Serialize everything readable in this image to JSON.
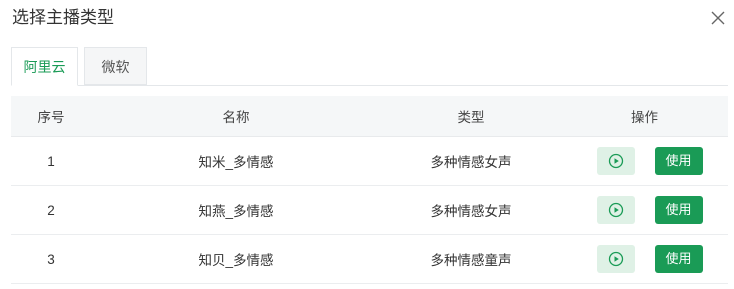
{
  "dialog": {
    "title": "选择主播类型"
  },
  "tabs": [
    {
      "label": "阿里云",
      "active": true
    },
    {
      "label": "微软",
      "active": false
    }
  ],
  "table": {
    "headers": [
      "序号",
      "名称",
      "类型",
      "操作"
    ],
    "rows": [
      {
        "index": "1",
        "name": "知米_多情感",
        "type": "多种情感女声",
        "use_label": "使用"
      },
      {
        "index": "2",
        "name": "知燕_多情感",
        "type": "多种情感女声",
        "use_label": "使用"
      },
      {
        "index": "3",
        "name": "知贝_多情感",
        "type": "多种情感童声",
        "use_label": "使用"
      }
    ]
  },
  "colors": {
    "accent": "#1a9b56",
    "play_bg": "#dff1e6",
    "header_bg": "#f5f7f8"
  },
  "icons": {
    "close": "close-icon",
    "play": "play-icon"
  }
}
